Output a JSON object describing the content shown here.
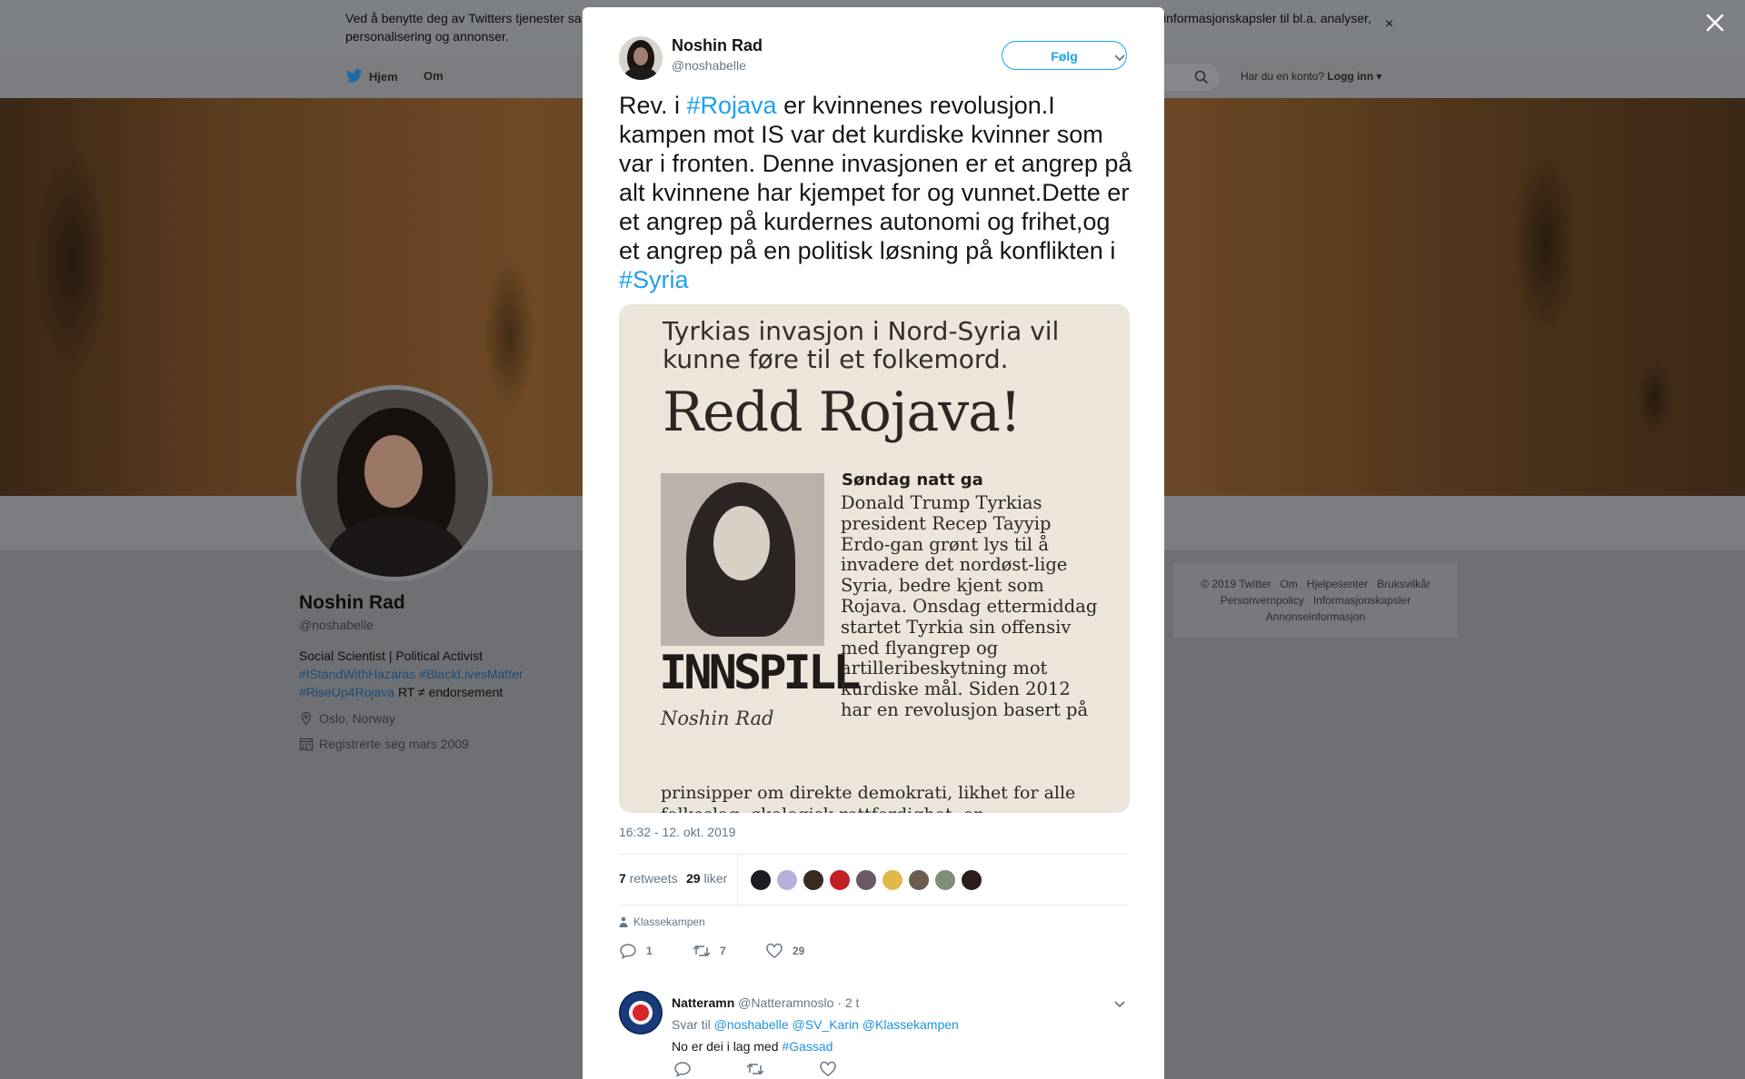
{
  "cookie": {
    "text_left": "Ved å benytte deg av Twitters tjenester sa",
    "text_right": "informasjonskapsler til bl.a. analyser,",
    "text_line2": "personalisering og annonser.",
    "close": "×"
  },
  "nav": {
    "home": "Hjem",
    "about": "Om",
    "login_question": "Har du en konto?",
    "login": "Logg inn"
  },
  "profile": {
    "name": "Noshin Rad",
    "handle": "@noshabelle",
    "bio_text": "Social Scientist | Political Activist",
    "bio_tags": [
      "#IStandWithHazaras",
      "#BlackLivesMatter",
      "#RiseUp4Rojava"
    ],
    "bio_tail": "RT ≠ endorsement",
    "location": "Oslo, Norway",
    "joined": "Registrerte seg mars 2009"
  },
  "footer": {
    "row1": [
      "© 2019 Twitter",
      "Om",
      "Hjelpesenter",
      "Bruksvilkår"
    ],
    "row2": [
      "Personvernpolicy",
      "Informasjonskapsler"
    ],
    "row3": [
      "Annonseinformasjon"
    ]
  },
  "tweet": {
    "author": "Noshin Rad",
    "handle": "@noshabelle",
    "follow": "Følg",
    "text_parts": [
      {
        "t": "Rev. i ",
        "link": false
      },
      {
        "t": "#Rojava",
        "link": true
      },
      {
        "t": " er kvinnenes revolusjon.I kampen mot IS var det kurdiske kvinner som var i fronten. Denne invasjonen er et angrep på alt kvinnene har kjempet for og vunnet.Dette er et angrep på kurdernes autonomi og frihet,og et angrep på en politisk løsning på konflikten i ",
        "link": false
      },
      {
        "t": "#Syria",
        "link": true
      }
    ],
    "timestamp": "16:32 - 12. okt. 2019",
    "retweets_count": "7",
    "retweets_label": "retweets",
    "likes_count": "29",
    "likes_label": "liker",
    "place": "Klassekampen",
    "reply_count": "1",
    "retweet_count": "7",
    "like_count": "29"
  },
  "clipping": {
    "headline": "Tyrkias invasjon i Nord-Syria vil kunne føre til et folkemord.",
    "title": "Redd Rojava!",
    "section": "INNSPILL",
    "author": "Noshin Rad",
    "lead": "Søndag natt ga",
    "body": "Donald Trump Tyrkias president Recep Tayyip Erdo-gan grønt lys til å invadere det nordøst-lige Syria, bedre kjent som Rojava. Onsdag ettermiddag startet Tyrkia sin offensiv med flyangrep og artilleribeskytning mot kurdiske mål. Siden 2012 har en revolusjon basert på",
    "foot": "prinsipper om direkte demokrati, likhet for alle folkeslag, økologisk rettferdighet, en"
  },
  "likers": [
    "#1b1d22",
    "#b7b0de",
    "#3a2a22",
    "#c22027",
    "#6b5a66",
    "#e1b84a",
    "#6e5c50",
    "#7f8f74",
    "#2a1e1c"
  ],
  "reply": {
    "name": "Natteramn",
    "handle": "@Natteramnoslo",
    "time": "· 2 t",
    "to_label": "Svar til",
    "to_users": [
      "@noshabelle",
      "@SV_Karin",
      "@Klassekampen"
    ],
    "text": "No er dei i lag med",
    "tag": "#Gassad"
  }
}
